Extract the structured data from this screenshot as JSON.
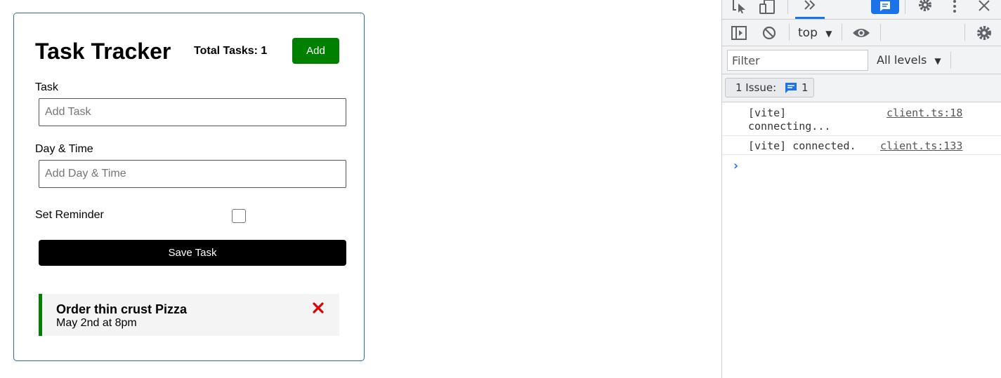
{
  "app": {
    "title": "Task Tracker",
    "total_tasks_text": "Total Tasks: 1",
    "add_button": "Add",
    "form": {
      "task_label": "Task",
      "task_placeholder": "Add Task",
      "task_value": "",
      "day_label": "Day & Time",
      "day_placeholder": "Add Day & Time",
      "day_value": "",
      "reminder_label": "Set Reminder",
      "reminder_checked": false,
      "save_button": "Save Task"
    },
    "tasks": [
      {
        "text": "Order thin crust Pizza",
        "day": "May 2nd at 8pm",
        "reminder": true
      }
    ],
    "colors": {
      "accent": "#008000",
      "delete": "#e00000",
      "border": "#2b6c8e"
    }
  },
  "devtools": {
    "tabs_overflow_icon": "chevrons-right-icon",
    "context": "top",
    "filter_placeholder": "Filter",
    "levels": "All levels",
    "issues_label": "1 Issue:",
    "issues_count": "1",
    "messages": [
      {
        "text_line1": "[vite]",
        "text_line2": "connecting...",
        "source": "client.ts:18"
      },
      {
        "text_line1": "[vite] connected.",
        "source": "client.ts:133"
      }
    ]
  }
}
